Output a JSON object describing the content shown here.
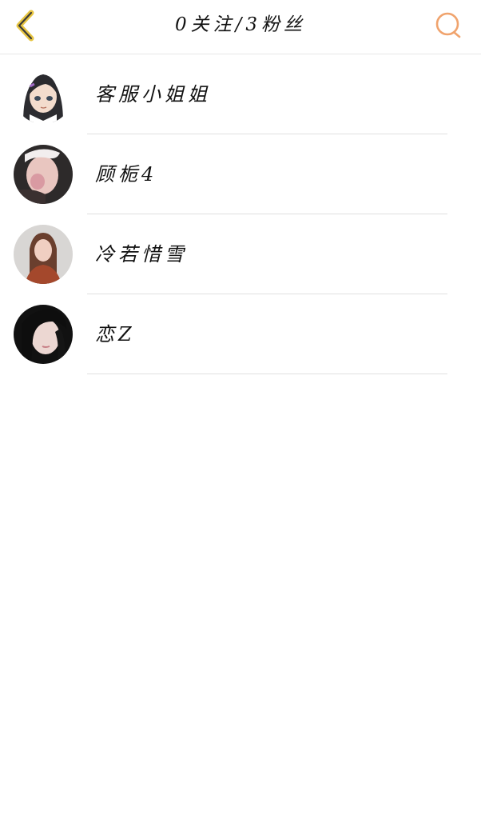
{
  "header": {
    "title": "0关注/3粉丝",
    "back_icon": "chevron-left-icon",
    "search_icon": "search-icon",
    "colors": {
      "back_accent": "#e7c542",
      "search_accent": "#f0a36d"
    }
  },
  "users": [
    {
      "name": "客服小姐姐",
      "avatar": "anime-girl-avatar"
    },
    {
      "name": "顾栀4",
      "avatar": "photo-avatar"
    },
    {
      "name": "冷若惜雪",
      "avatar": "photo-avatar"
    },
    {
      "name": "恋Z",
      "avatar": "photo-avatar"
    }
  ]
}
